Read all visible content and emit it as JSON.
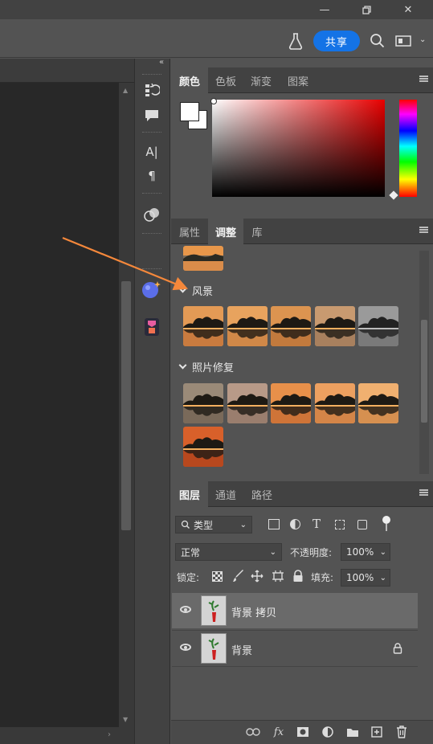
{
  "header": {
    "share_label": "共享"
  },
  "color_panel": {
    "tabs": [
      "颜色",
      "色板",
      "渐变",
      "图案"
    ]
  },
  "adjust_panel": {
    "tabs": [
      "属性",
      "调整",
      "库"
    ],
    "sections": [
      {
        "label": "风景"
      },
      {
        "label": "照片修复"
      }
    ]
  },
  "layers_panel": {
    "tabs": [
      "图层",
      "通道",
      "路径"
    ],
    "filter_label": "类型",
    "blend_mode": "正常",
    "opacity_label": "不透明度:",
    "opacity_value": "100%",
    "lock_label": "锁定:",
    "fill_label": "填充:",
    "fill_value": "100%",
    "layers": [
      {
        "name": "背景 拷贝",
        "selected": true
      },
      {
        "name": "背景",
        "locked": true
      }
    ],
    "bottom_icons": [
      "link-icon",
      "fx-icon",
      "mask-icon",
      "adjustment-icon",
      "folder-icon",
      "new-layer-icon",
      "trash-icon"
    ],
    "fx_label": "fx"
  },
  "strip": {
    "text_tool_glyph": "A|",
    "paragraph_glyph": "¶"
  },
  "colors": {
    "accent": "#1473e6",
    "annotation_arrow": "#f5883b"
  }
}
